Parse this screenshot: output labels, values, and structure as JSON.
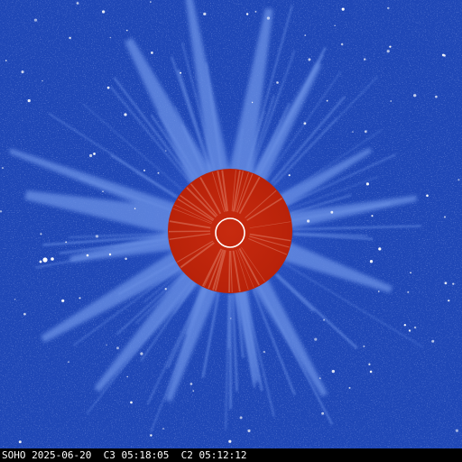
{
  "image": {
    "caption": "SOHO 2025-06-20  C3 05:18:05  C2 05:12:12"
  },
  "colors": {
    "sky": "#1f47b6",
    "sky_dark": "#11318f",
    "streamer": "#6c92e6",
    "occulter": "#c2260d",
    "occulter_edge": "#b22008",
    "sun_outline": "#ffffff",
    "caption_bg": "#000000",
    "caption_text": "#ffffff"
  }
}
